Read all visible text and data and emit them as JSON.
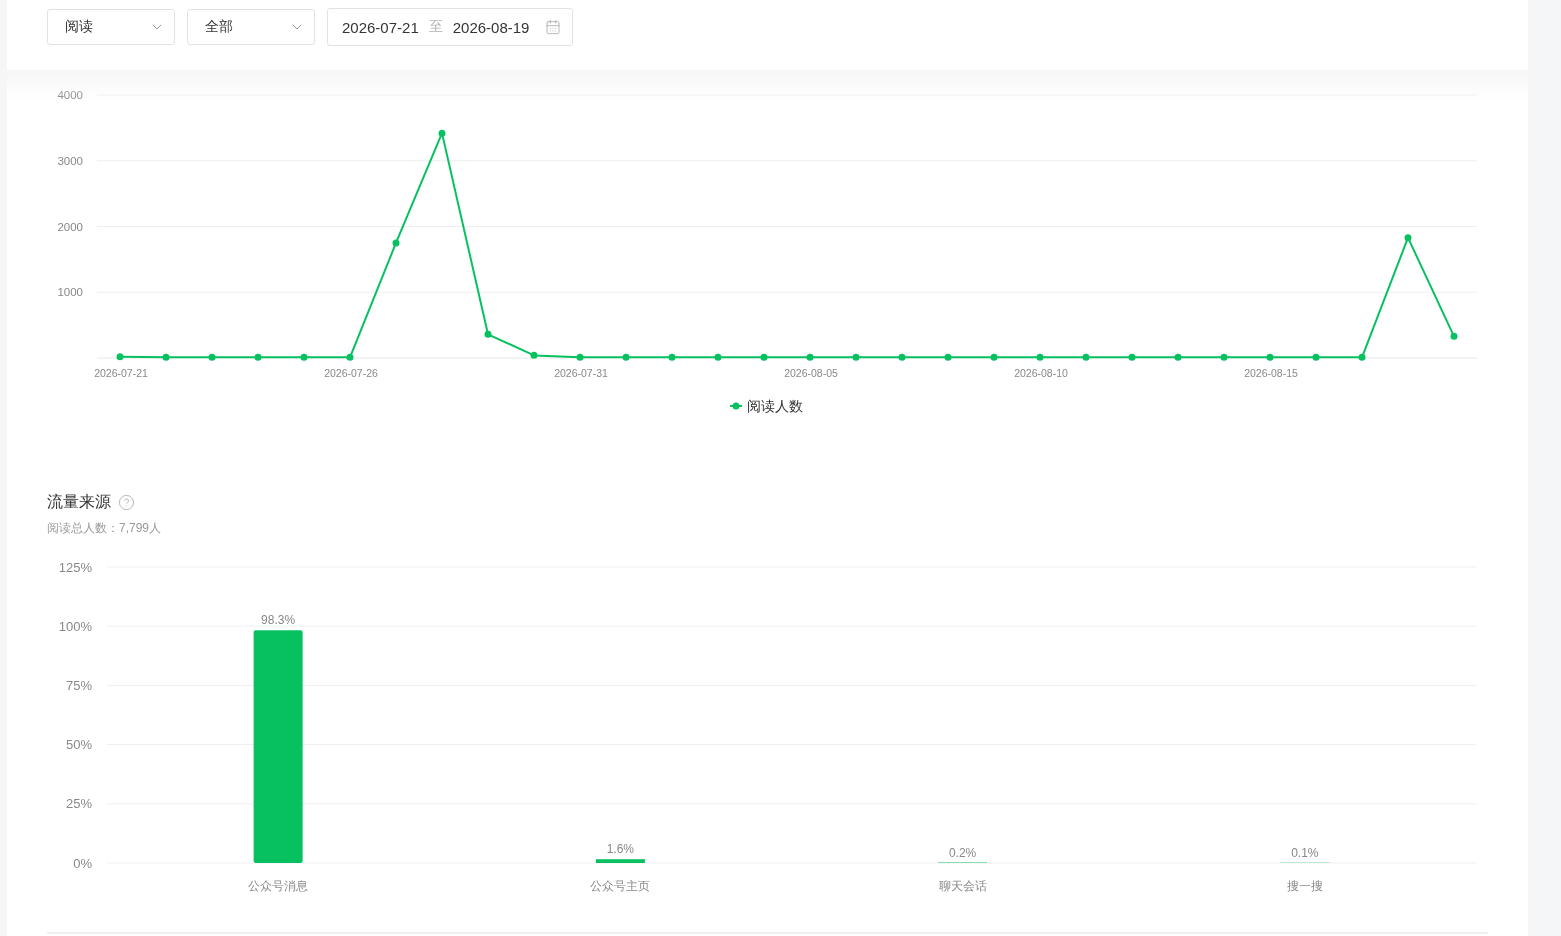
{
  "filter_bar": {
    "metric_select": {
      "value": "阅读"
    },
    "scope_select": {
      "value": "全部"
    },
    "date_range": {
      "start": "2026-07-21",
      "separator": "至",
      "end": "2026-08-19"
    }
  },
  "trend_section": {
    "chart_data": {
      "type": "line",
      "categories": [
        "2026-07-21",
        null,
        null,
        null,
        null,
        "2026-07-26",
        null,
        null,
        null,
        null,
        "2026-07-31",
        null,
        null,
        null,
        null,
        "2026-08-05",
        null,
        null,
        null,
        null,
        "2026-08-10",
        null,
        null,
        null,
        null,
        "2026-08-15",
        null,
        null,
        null,
        null
      ],
      "series": [
        {
          "name": "阅读人数",
          "color": "#07c160",
          "marker": "circle",
          "values": [
            20,
            10,
            10,
            10,
            10,
            10,
            1750,
            3420,
            360,
            40,
            10,
            10,
            10,
            10,
            10,
            10,
            10,
            10,
            10,
            10,
            10,
            10,
            10,
            10,
            10,
            10,
            10,
            10,
            1830,
            330
          ]
        }
      ],
      "ylim": [
        0,
        4000
      ],
      "yticks": [
        1000,
        2000,
        3000,
        4000
      ],
      "grid": true
    }
  },
  "source_section": {
    "title": "流量来源",
    "subtitle": "阅读总人数：7,799人",
    "chart_data": {
      "type": "bar",
      "categories": [
        "公众号消息",
        "公众号主页",
        "聊天会话",
        "搜一搜"
      ],
      "values": [
        98.3,
        1.6,
        0.2,
        0.1
      ],
      "ylim": [
        0,
        125
      ],
      "yticks": [
        {
          "value": 0,
          "label": "0%"
        },
        {
          "value": 25,
          "label": "25%"
        },
        {
          "value": 50,
          "label": "50%"
        },
        {
          "value": 75,
          "label": "75%"
        },
        {
          "value": 100,
          "label": "100%"
        },
        {
          "value": 125,
          "label": "125%"
        }
      ],
      "value_labels": [
        "98.3%",
        "1.6%",
        "0.2%",
        "0.1%"
      ],
      "grid": true
    }
  }
}
